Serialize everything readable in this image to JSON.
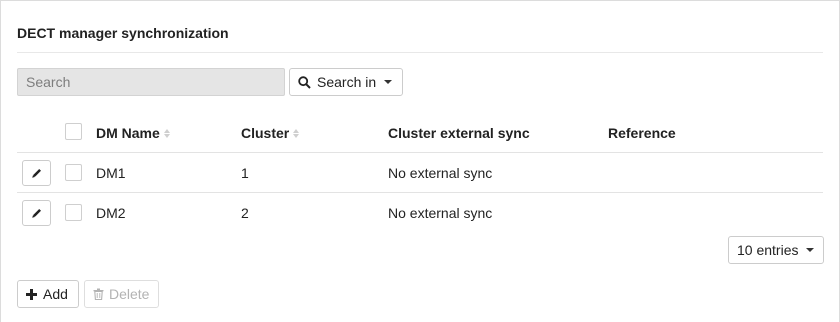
{
  "panel": {
    "title": "DECT manager synchronization"
  },
  "search": {
    "placeholder": "Search",
    "value": "",
    "search_in_label": "Search in"
  },
  "table": {
    "columns": [
      "DM Name",
      "Cluster",
      "Cluster external sync",
      "Reference"
    ],
    "rows": [
      {
        "dm_name": "DM1",
        "cluster": "1",
        "cluster_external_sync": "No external sync",
        "reference": ""
      },
      {
        "dm_name": "DM2",
        "cluster": "2",
        "cluster_external_sync": "No external sync",
        "reference": ""
      }
    ]
  },
  "pagination": {
    "entries_label": "10 entries"
  },
  "actions": {
    "add_label": "Add",
    "delete_label": "Delete"
  },
  "icons": {
    "search": "search-icon",
    "edit": "pencil-icon",
    "add": "plus-icon",
    "delete": "trash-icon",
    "sort": "sort-icon",
    "caret": "caret-down-icon"
  }
}
